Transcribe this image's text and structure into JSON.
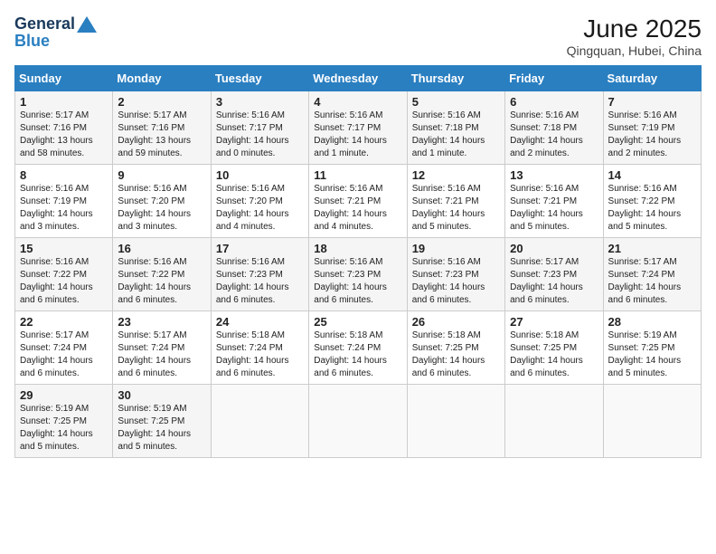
{
  "logo": {
    "general": "General",
    "blue": "Blue"
  },
  "title": "June 2025",
  "subtitle": "Qingquan, Hubei, China",
  "days": [
    "Sunday",
    "Monday",
    "Tuesday",
    "Wednesday",
    "Thursday",
    "Friday",
    "Saturday"
  ],
  "weeks": [
    [
      {
        "day": "1",
        "sunrise": "Sunrise: 5:17 AM",
        "sunset": "Sunset: 7:16 PM",
        "daylight": "Daylight: 13 hours and 58 minutes."
      },
      {
        "day": "2",
        "sunrise": "Sunrise: 5:17 AM",
        "sunset": "Sunset: 7:16 PM",
        "daylight": "Daylight: 13 hours and 59 minutes."
      },
      {
        "day": "3",
        "sunrise": "Sunrise: 5:16 AM",
        "sunset": "Sunset: 7:17 PM",
        "daylight": "Daylight: 14 hours and 0 minutes."
      },
      {
        "day": "4",
        "sunrise": "Sunrise: 5:16 AM",
        "sunset": "Sunset: 7:17 PM",
        "daylight": "Daylight: 14 hours and 1 minute."
      },
      {
        "day": "5",
        "sunrise": "Sunrise: 5:16 AM",
        "sunset": "Sunset: 7:18 PM",
        "daylight": "Daylight: 14 hours and 1 minute."
      },
      {
        "day": "6",
        "sunrise": "Sunrise: 5:16 AM",
        "sunset": "Sunset: 7:18 PM",
        "daylight": "Daylight: 14 hours and 2 minutes."
      },
      {
        "day": "7",
        "sunrise": "Sunrise: 5:16 AM",
        "sunset": "Sunset: 7:19 PM",
        "daylight": "Daylight: 14 hours and 2 minutes."
      }
    ],
    [
      {
        "day": "8",
        "sunrise": "Sunrise: 5:16 AM",
        "sunset": "Sunset: 7:19 PM",
        "daylight": "Daylight: 14 hours and 3 minutes."
      },
      {
        "day": "9",
        "sunrise": "Sunrise: 5:16 AM",
        "sunset": "Sunset: 7:20 PM",
        "daylight": "Daylight: 14 hours and 3 minutes."
      },
      {
        "day": "10",
        "sunrise": "Sunrise: 5:16 AM",
        "sunset": "Sunset: 7:20 PM",
        "daylight": "Daylight: 14 hours and 4 minutes."
      },
      {
        "day": "11",
        "sunrise": "Sunrise: 5:16 AM",
        "sunset": "Sunset: 7:21 PM",
        "daylight": "Daylight: 14 hours and 4 minutes."
      },
      {
        "day": "12",
        "sunrise": "Sunrise: 5:16 AM",
        "sunset": "Sunset: 7:21 PM",
        "daylight": "Daylight: 14 hours and 5 minutes."
      },
      {
        "day": "13",
        "sunrise": "Sunrise: 5:16 AM",
        "sunset": "Sunset: 7:21 PM",
        "daylight": "Daylight: 14 hours and 5 minutes."
      },
      {
        "day": "14",
        "sunrise": "Sunrise: 5:16 AM",
        "sunset": "Sunset: 7:22 PM",
        "daylight": "Daylight: 14 hours and 5 minutes."
      }
    ],
    [
      {
        "day": "15",
        "sunrise": "Sunrise: 5:16 AM",
        "sunset": "Sunset: 7:22 PM",
        "daylight": "Daylight: 14 hours and 6 minutes."
      },
      {
        "day": "16",
        "sunrise": "Sunrise: 5:16 AM",
        "sunset": "Sunset: 7:22 PM",
        "daylight": "Daylight: 14 hours and 6 minutes."
      },
      {
        "day": "17",
        "sunrise": "Sunrise: 5:16 AM",
        "sunset": "Sunset: 7:23 PM",
        "daylight": "Daylight: 14 hours and 6 minutes."
      },
      {
        "day": "18",
        "sunrise": "Sunrise: 5:16 AM",
        "sunset": "Sunset: 7:23 PM",
        "daylight": "Daylight: 14 hours and 6 minutes."
      },
      {
        "day": "19",
        "sunrise": "Sunrise: 5:16 AM",
        "sunset": "Sunset: 7:23 PM",
        "daylight": "Daylight: 14 hours and 6 minutes."
      },
      {
        "day": "20",
        "sunrise": "Sunrise: 5:17 AM",
        "sunset": "Sunset: 7:23 PM",
        "daylight": "Daylight: 14 hours and 6 minutes."
      },
      {
        "day": "21",
        "sunrise": "Sunrise: 5:17 AM",
        "sunset": "Sunset: 7:24 PM",
        "daylight": "Daylight: 14 hours and 6 minutes."
      }
    ],
    [
      {
        "day": "22",
        "sunrise": "Sunrise: 5:17 AM",
        "sunset": "Sunset: 7:24 PM",
        "daylight": "Daylight: 14 hours and 6 minutes."
      },
      {
        "day": "23",
        "sunrise": "Sunrise: 5:17 AM",
        "sunset": "Sunset: 7:24 PM",
        "daylight": "Daylight: 14 hours and 6 minutes."
      },
      {
        "day": "24",
        "sunrise": "Sunrise: 5:18 AM",
        "sunset": "Sunset: 7:24 PM",
        "daylight": "Daylight: 14 hours and 6 minutes."
      },
      {
        "day": "25",
        "sunrise": "Sunrise: 5:18 AM",
        "sunset": "Sunset: 7:24 PM",
        "daylight": "Daylight: 14 hours and 6 minutes."
      },
      {
        "day": "26",
        "sunrise": "Sunrise: 5:18 AM",
        "sunset": "Sunset: 7:25 PM",
        "daylight": "Daylight: 14 hours and 6 minutes."
      },
      {
        "day": "27",
        "sunrise": "Sunrise: 5:18 AM",
        "sunset": "Sunset: 7:25 PM",
        "daylight": "Daylight: 14 hours and 6 minutes."
      },
      {
        "day": "28",
        "sunrise": "Sunrise: 5:19 AM",
        "sunset": "Sunset: 7:25 PM",
        "daylight": "Daylight: 14 hours and 5 minutes."
      }
    ],
    [
      {
        "day": "29",
        "sunrise": "Sunrise: 5:19 AM",
        "sunset": "Sunset: 7:25 PM",
        "daylight": "Daylight: 14 hours and 5 minutes."
      },
      {
        "day": "30",
        "sunrise": "Sunrise: 5:19 AM",
        "sunset": "Sunset: 7:25 PM",
        "daylight": "Daylight: 14 hours and 5 minutes."
      },
      null,
      null,
      null,
      null,
      null
    ]
  ]
}
